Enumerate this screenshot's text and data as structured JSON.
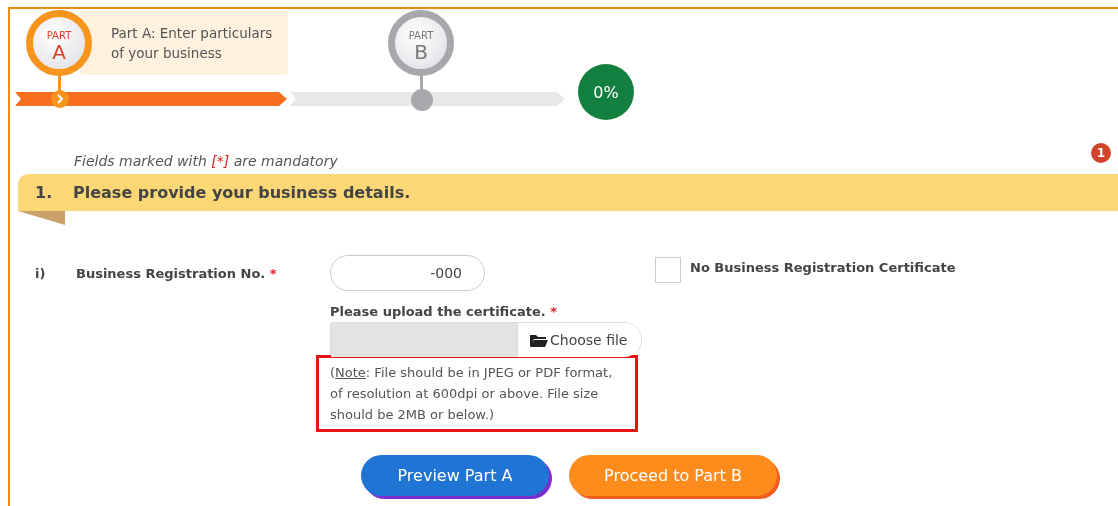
{
  "steps": [
    {
      "part_label": "PART",
      "letter": "A",
      "description": "Part A: Enter particulars of your business",
      "selected": true
    },
    {
      "part_label": "PART",
      "letter": "B",
      "selected": false
    }
  ],
  "progress": {
    "reading": "0%"
  },
  "mandatory_note": {
    "before": "Fields marked with ",
    "marker": "[*]",
    "after": " are mandatory"
  },
  "notification_badge": "1",
  "section": {
    "number": "1.",
    "title": "Please provide your business details."
  },
  "field": {
    "index": "i)",
    "label": "Business Registration No.",
    "required_mark": "*",
    "value": "-000"
  },
  "no_certificate": {
    "label": "No Business Registration Certificate",
    "checked": false
  },
  "upload": {
    "label": "Please upload the certificate.",
    "required_mark": "*",
    "button": "Choose file"
  },
  "note": {
    "open": "(",
    "label": "Note",
    "text": ": File should be in JPEG or PDF format, of resolution at 600dpi or above. File size should be 2MB or below.)"
  },
  "buttons": [
    {
      "label": "Preview Part A",
      "kind": "secondary"
    },
    {
      "label": "Proceed to Part B",
      "kind": "primary"
    }
  ]
}
